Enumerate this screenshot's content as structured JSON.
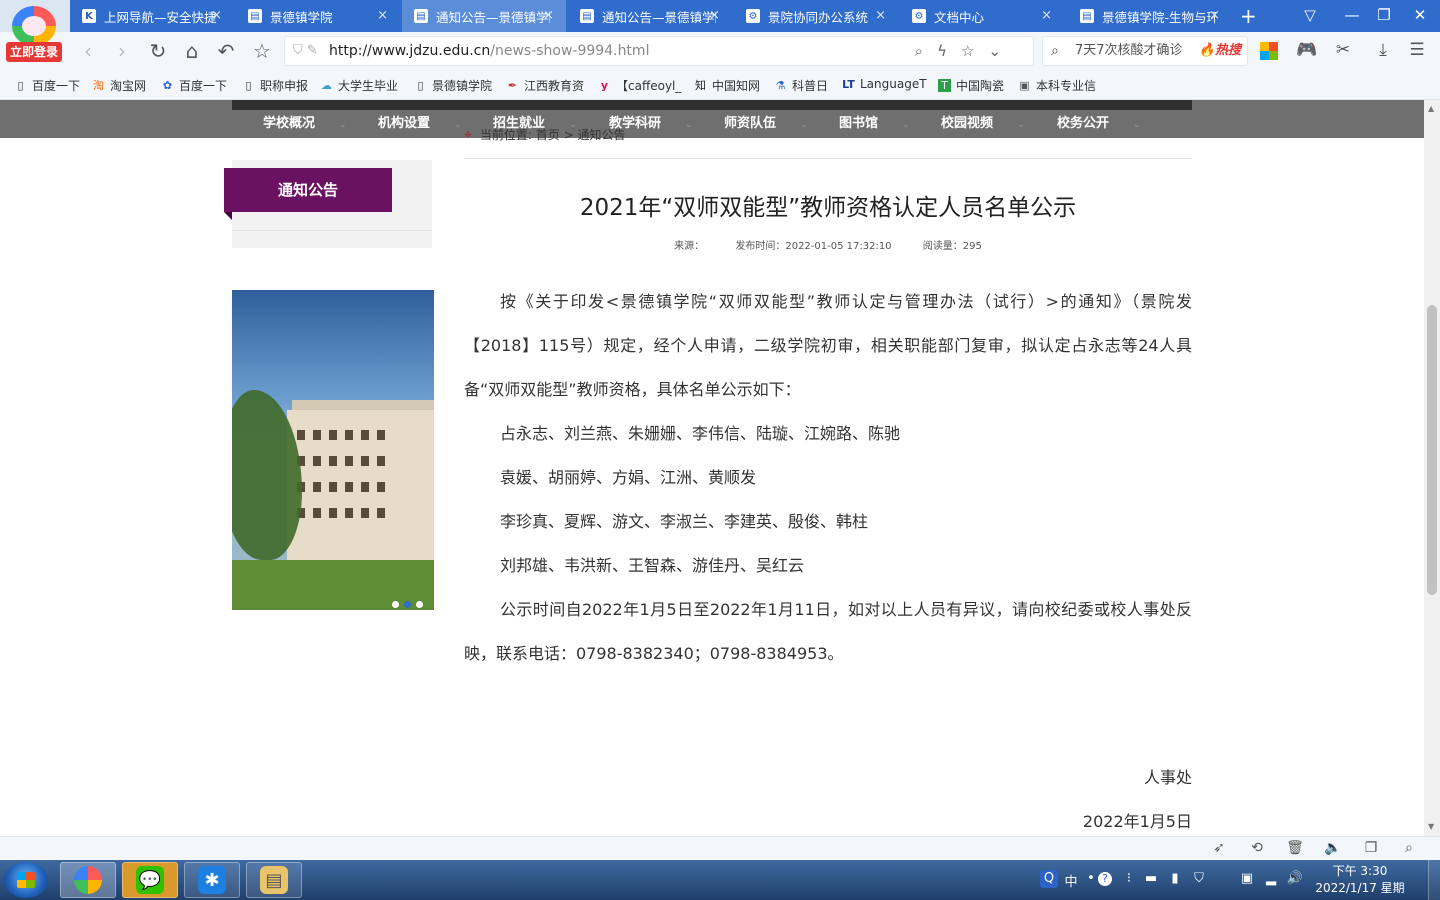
{
  "browser": {
    "login_label": "立即登录",
    "tabs": [
      {
        "label": "上网导航—安全快捷",
        "icon": "k-icon"
      },
      {
        "label": "景德镇学院",
        "icon": "page-icon"
      },
      {
        "label": "通知公告—景德镇学院",
        "icon": "page-icon",
        "active": true
      },
      {
        "label": "通知公告—景德镇学院",
        "icon": "page-icon"
      },
      {
        "label": "景院协同办公系统",
        "icon": "gear-icon"
      },
      {
        "label": "文档中心",
        "icon": "gear-icon"
      },
      {
        "label": "景德镇学院-生物与环境",
        "icon": "page-icon"
      }
    ],
    "tab_close": "×",
    "new_tab": "+",
    "url_domain": "http://www.jdzu.edu.cn",
    "url_path": "/news-show-9994.html",
    "search_text": "7天7次核酸才确诊",
    "search_hot": "🔥热搜"
  },
  "bookmarks": [
    {
      "label": "百度一下",
      "icon": "page-icon"
    },
    {
      "label": "淘宝网",
      "icon": "taobao-icon"
    },
    {
      "label": "百度一下",
      "icon": "baidu-paw-icon"
    },
    {
      "label": "职称申报",
      "icon": "page-icon"
    },
    {
      "label": "大学生毕业",
      "icon": "cloud-icon"
    },
    {
      "label": "景德镇学院",
      "icon": "page-icon"
    },
    {
      "label": "江西教育资",
      "icon": "pen-icon"
    },
    {
      "label": "【caffeoyl_",
      "icon": "y-icon"
    },
    {
      "label": "中国知网",
      "icon": "cnki-icon"
    },
    {
      "label": "科普日",
      "icon": "flask-icon"
    },
    {
      "label": "LanguageT",
      "icon": "lt-icon"
    },
    {
      "label": "中国陶瓷",
      "icon": "t-icon"
    },
    {
      "label": "本科专业信",
      "icon": "image-icon"
    }
  ],
  "site_nav": [
    "学校概况",
    "机构设置",
    "招生就业",
    "教学科研",
    "师资队伍",
    "图书馆",
    "校园视频",
    "校务公开"
  ],
  "breadcrumb": {
    "prefix": "当前位置:",
    "home": "首页",
    "sep": " > ",
    "current": "通知公告"
  },
  "sidebar": {
    "title": "通知公告"
  },
  "article": {
    "title": "2021年“双师双能型”教师资格认定人员名单公示",
    "meta_source": "来源：",
    "meta_time": "发布时间：2022-01-05 17:32:10",
    "meta_views": "阅读量：295",
    "p1": "按《关于印发<景德镇学院“双师双能型”教师认定与管理办法（试行）>的通知》（景院发【2018】115号）规定，经个人申请，二级学院初审，相关职能部门复审，拟认定占永志等24人具备“双师双能型”教师资格，具体名单公示如下：",
    "names_1": "占永志、刘兰燕、朱姗姗、李伟信、陆璇、江婉路、陈驰",
    "names_2": "袁媛、胡丽婷、方娟、江洲、黄顺发",
    "names_3": "李珍真、夏辉、游文、李淑兰、李建英、殷俊、韩柱",
    "names_4": "刘邦雄、韦洪新、王智森、游佳丹、吴红云",
    "p2": "公示时间自2022年1月5日至2022年1月11日，如对以上人员有异议，请向校纪委或校人事处反映，联系电话：0798-8382340；0798-8384953。",
    "sign_dept": "人事处",
    "sign_date": "2022年1月5日"
  },
  "taskbar": {
    "clock_time": "下午 3:30",
    "clock_date": "2022/1/17 星期一",
    "ime": "中"
  }
}
